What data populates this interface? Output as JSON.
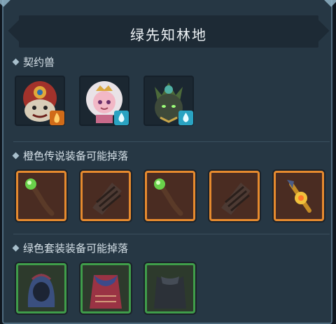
{
  "title": "绿先知林地",
  "sections": {
    "beasts": {
      "label": "契约兽"
    },
    "orange": {
      "label": "橙色传说装备可能掉落"
    },
    "green": {
      "label": "绿色套装装备可能掉落"
    }
  },
  "beasts": [
    {
      "icon": "red-hooded-beast-icon",
      "element_icon": "fire-element-icon"
    },
    {
      "icon": "pink-haired-girl-beast-icon",
      "element_icon": "water-drop-icon"
    },
    {
      "icon": "forest-spirit-beast-icon",
      "element_icon": "water-drop-icon"
    }
  ],
  "orange_items": [
    "green-orb-staff-icon",
    "wrapped-bracer-icon",
    "green-orb-staff-icon",
    "wrapped-bracer-icon",
    "gem-scepter-icon"
  ],
  "green_items": [
    "blue-hood-icon",
    "red-robe-icon",
    "dark-cloak-icon"
  ],
  "colors": {
    "legendary_border": "#e68a2e",
    "set_border": "#3f9d4a",
    "panel_bg": "#263744",
    "fire_badge": "#d16b18",
    "water_badge": "#2aa3c2"
  }
}
